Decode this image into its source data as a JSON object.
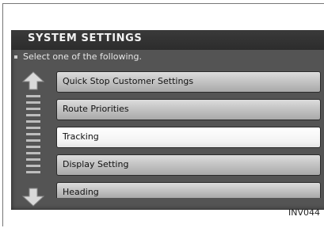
{
  "screen": {
    "title": "SYSTEM SETTINGS",
    "subtitle": "Select one of the following.",
    "menu_items": [
      {
        "label": "Quick Stop Customer Settings"
      },
      {
        "label": "Route Priorities"
      },
      {
        "label": "Tracking"
      },
      {
        "label": "Display Setting"
      },
      {
        "label": "Heading"
      }
    ],
    "selected_item": "Tracking",
    "scroll_icons": {
      "up": "up-arrow-icon",
      "down": "down-arrow-icon"
    }
  },
  "figure_code": "INV044"
}
